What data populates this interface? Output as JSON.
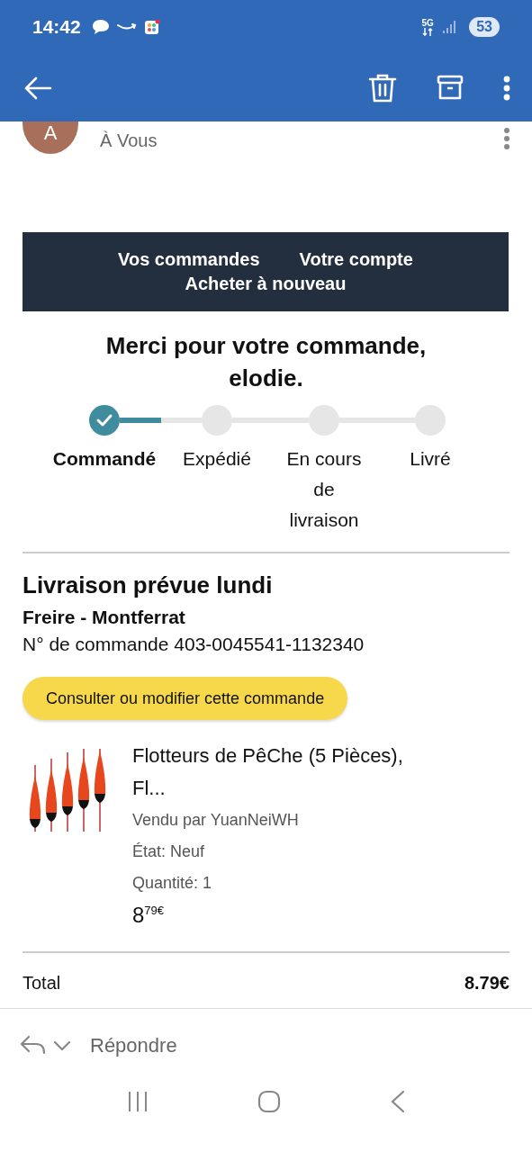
{
  "status_bar": {
    "time": "14:42",
    "network": "5G",
    "battery": "53"
  },
  "toolbar": {
    "actions": [
      {
        "kind": "delete"
      },
      {
        "kind": "archive"
      },
      {
        "kind": "more"
      }
    ]
  },
  "sender": {
    "avatar": "A",
    "recipient": "À Vous"
  },
  "email": {
    "nav_links": [
      {
        "label": "Vos commandes"
      },
      {
        "label": "Votre compte"
      },
      {
        "label": "Acheter à nouveau"
      }
    ],
    "title": "Merci pour votre commande, elodie.",
    "steps": [
      {
        "label": "Commandé",
        "done": true
      },
      {
        "label": "Expédié",
        "done": false
      },
      {
        "label": "En cours de livraison",
        "done": false
      },
      {
        "label": "Livré",
        "done": false
      }
    ],
    "delivery": "Livraison prévue lundi",
    "address": "Freire - Montferrat",
    "order_number": "N° de commande 403-0045541-1132340",
    "button": "Consulter ou modifier cette commande",
    "item": {
      "kind": "picture",
      "title": "Flotteurs de PêChe (5 Pièces), Fl...",
      "seller": "Vendu par YuanNeiWH",
      "condition": "État: Neuf",
      "quantity": "Quantité: 1",
      "price": "8$^{79€}$"
    },
    "total_label": "Total",
    "total": "8.79€"
  },
  "reply": {
    "label": "Répondre"
  }
}
